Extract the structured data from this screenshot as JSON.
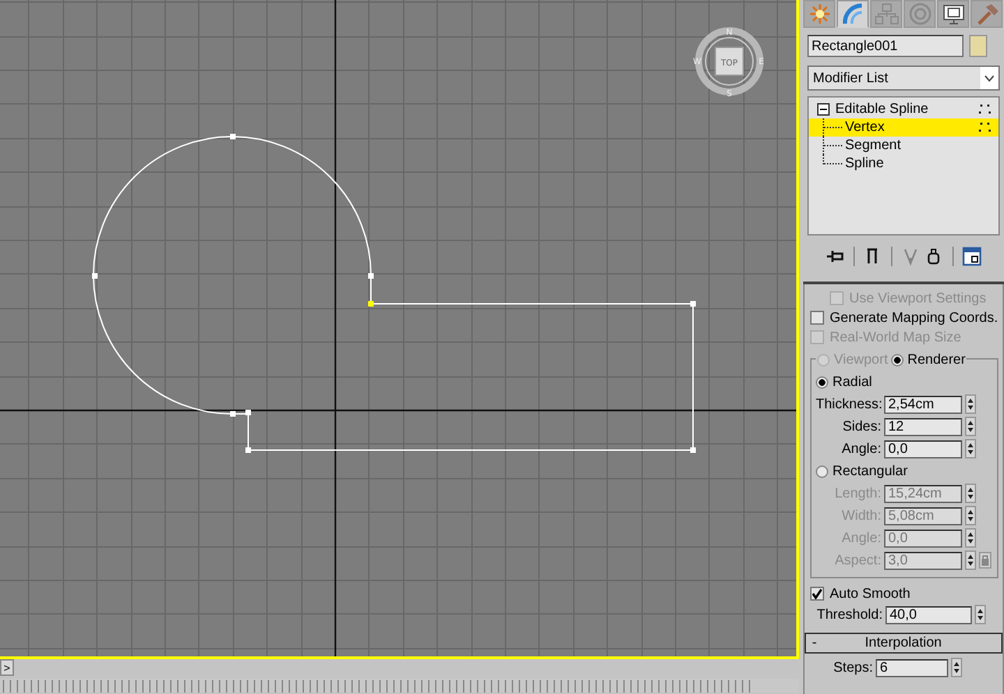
{
  "viewport": {
    "viewcube": {
      "face": "TOP",
      "compass": [
        "N",
        "W",
        "E",
        "S"
      ]
    },
    "active": true
  },
  "command_tabs": [
    {
      "kind": "create",
      "selected": false
    },
    {
      "kind": "modify",
      "selected": true
    },
    {
      "kind": "hierarchy",
      "selected": false
    },
    {
      "kind": "motion",
      "selected": false
    },
    {
      "kind": "display",
      "selected": false
    },
    {
      "kind": "utilities",
      "selected": false
    }
  ],
  "object_name": {
    "value": "Rectangle001"
  },
  "modifier_list": {
    "value": "Modifier List"
  },
  "stack": [
    {
      "label": "Editable Spline",
      "expanded": true,
      "children": [
        {
          "label": "Vertex",
          "selected": true
        },
        {
          "label": "Segment",
          "selected": false
        },
        {
          "label": "Spline",
          "selected": false
        }
      ]
    }
  ],
  "stack_toolbar": [
    {
      "kind": "pin",
      "disabled": false
    },
    {
      "kind": "show-end-result",
      "disabled": false
    },
    {
      "kind": "make-unique",
      "disabled": true
    },
    {
      "kind": "remove",
      "disabled": false
    },
    {
      "kind": "configure",
      "disabled": false
    }
  ],
  "rendering": {
    "checkboxes": [
      {
        "label": "Use Viewport Settings",
        "checked": false,
        "disabled": true
      },
      {
        "label": "Generate Mapping Coords.",
        "checked": false,
        "disabled": false
      },
      {
        "label": "Real-World Map Size",
        "checked": false,
        "disabled": true
      }
    ],
    "modes": [
      {
        "label": "Viewport",
        "selected": false,
        "disabled": true
      },
      {
        "label": "Renderer",
        "selected": true,
        "disabled": false
      }
    ],
    "sections": [
      {
        "label": "Radial",
        "selected": true,
        "fields": [
          {
            "label": "Thickness:",
            "value": "2,54cm",
            "disabled": false
          },
          {
            "label": "Sides:",
            "value": "12",
            "disabled": false
          },
          {
            "label": "Angle:",
            "value": "0,0",
            "disabled": false
          }
        ]
      },
      {
        "label": "Rectangular",
        "selected": false,
        "fields": [
          {
            "label": "Length:",
            "value": "15,24cm",
            "disabled": true
          },
          {
            "label": "Width:",
            "value": "5,08cm",
            "disabled": true
          },
          {
            "label": "Angle:",
            "value": "0,0",
            "disabled": true
          },
          {
            "label": "Aspect:",
            "value": "3,0",
            "disabled": true,
            "lock": true
          }
        ]
      }
    ],
    "auto_smooth": {
      "label": "Auto Smooth",
      "checked": true
    },
    "threshold": {
      "label": "Threshold:",
      "value": "40,0",
      "disabled": false
    }
  },
  "interpolation": {
    "toggle": "-",
    "title": "Interpolation",
    "expanded": true,
    "steps": {
      "label": "Steps:",
      "value": "6",
      "disabled": false
    }
  },
  "timeline": {
    "button": ">"
  }
}
